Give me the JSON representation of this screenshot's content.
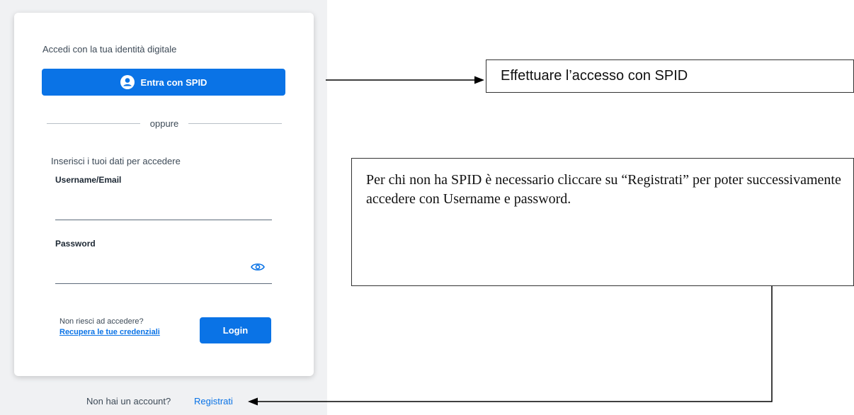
{
  "login_card": {
    "digital_identity_label": "Accedi con la tua identità digitale",
    "spid_button_label": "Entra con SPID",
    "divider_text": "oppure",
    "credentials_label": "Inserisci i tuoi dati per accedere",
    "username_label": "Username/Email",
    "username_value": "",
    "password_label": "Password",
    "password_value": "",
    "cant_access_text": "Non riesci ad accedere?",
    "recover_link": "Recupera le tue credenziali",
    "login_button_label": "Login"
  },
  "footer": {
    "no_account_text": "Non hai un account?",
    "register_link": "Registrati"
  },
  "annotations": {
    "spid_note": "Effettuare l’accesso con SPID",
    "register_note": "Per chi non ha SPID è necessario cliccare su “Registrati” per poter successivamente accedere con Username e password."
  },
  "colors": {
    "accent": "#0a73e6",
    "background": "#f0f1f3"
  },
  "icons": [
    "user-circle-icon",
    "eye-icon",
    "arrow-right-icon",
    "arrow-left-icon"
  ]
}
